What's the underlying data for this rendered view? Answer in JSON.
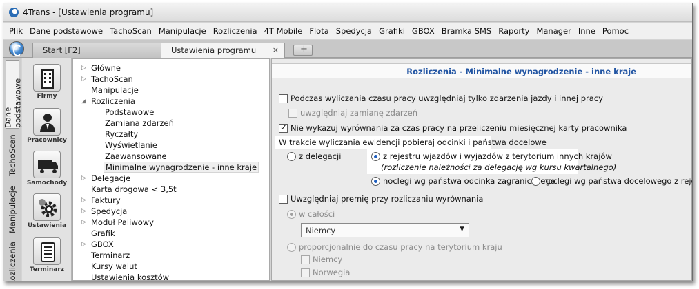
{
  "window": {
    "title": "4Trans - [Ustawienia programu]"
  },
  "menu": [
    "Plik",
    "Dane podstawowe",
    "TachoScan",
    "Manipulacje",
    "Rozliczenia",
    "4T Mobile",
    "Flota",
    "Spedycja",
    "Grafiki",
    "GBOX",
    "Bramka SMS",
    "Raporty",
    "Manager",
    "Inne",
    "Pomoc"
  ],
  "tabs": {
    "start": "Start [F2]",
    "settings": "Ustawienia programu",
    "close_symbol": "×"
  },
  "vertical_tabs": [
    "Dane podstawowe",
    "TachoScan",
    "Manipulacje",
    "Rozliczenia"
  ],
  "icon_bar": [
    "Firmy",
    "Pracownicy",
    "Samochody",
    "Ustawienia",
    "Terminarz"
  ],
  "tree": {
    "items": [
      "Główne",
      "TachoScan",
      "Manipulacje",
      "Rozliczenia",
      "Podstawowe",
      "Zamiana zdarzeń",
      "Ryczałty",
      "Wyświetlanie",
      "Zaawansowane",
      "Minimalne wynagrodzenie - inne kraje",
      "Delegacje",
      "Karta drogowa < 3,5t",
      "Faktury",
      "Spedycja",
      "Moduł Paliwowy",
      "Grafik",
      "GBOX",
      "Terminarz",
      "Kursy walut",
      "Ustawienia kosztów"
    ]
  },
  "panel": {
    "header": "Rozliczenia - Minimalne wynagrodzenie - inne kraje",
    "opt1": "Podczas wyliczania czasu pracy uwzględniaj tylko zdarzenia jazdy i innej pracy",
    "opt1_sub": "uwzględniaj zamianę zdarzeń",
    "opt2": "Nie wykazuj wyrównania za czas pracy na przeliczeniu miesięcznej karty pracownika",
    "section_label": "W trakcie wyliczania ewidencji pobieraj odcinki i państwa docelowe",
    "radio_delegacji": "z delegacji",
    "radio_rejestru": "z rejestru wjazdów i wyjazdów z terytorium innych krajów",
    "radio_rejestru_note": "(rozliczenie należności za delegację wg kursu kwartalnego)",
    "radio_noclegi_odcinka": "noclegi wg państwa odcinka zagranicznego",
    "radio_noclegi_docelowego": "noclegi wg państwa docelowego z rejestru",
    "opt3": "Uwzględniaj premię przy rozliczaniu wyrównania",
    "radio_calosci": "w całości",
    "country_select": "Niemcy",
    "radio_proporcjonalnie": "proporcjonalnie do czasu pracy na terytorium kraju",
    "cb_niemcy": "Niemcy",
    "cb_norwegia": "Norwegia"
  }
}
